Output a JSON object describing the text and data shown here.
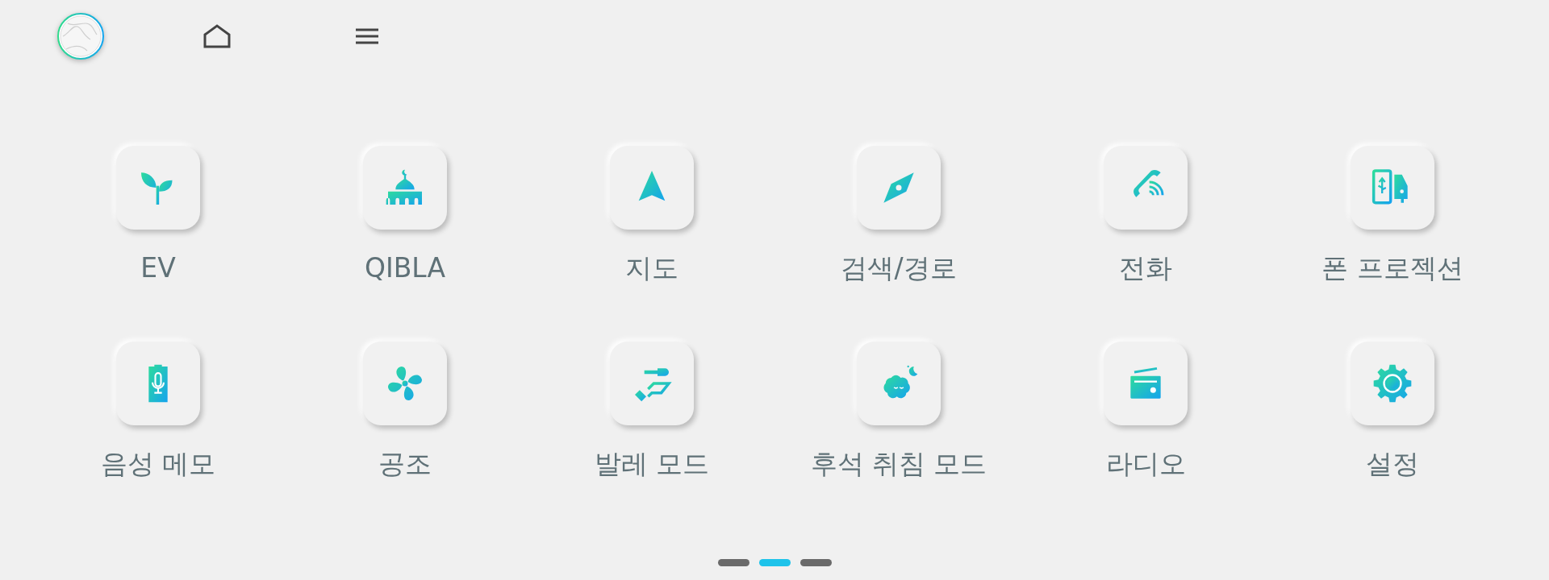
{
  "apps": [
    {
      "label": "EV"
    },
    {
      "label": "QIBLA"
    },
    {
      "label": "지도"
    },
    {
      "label": "검색/경로"
    },
    {
      "label": "전화"
    },
    {
      "label": "폰 프로젝션"
    },
    {
      "label": "음성 메모"
    },
    {
      "label": "공조"
    },
    {
      "label": "발레 모드"
    },
    {
      "label": "후석 취침 모드"
    },
    {
      "label": "라디오"
    },
    {
      "label": "설정"
    }
  ],
  "pages": [
    {
      "selected": false
    },
    {
      "selected": true
    },
    {
      "selected": false
    }
  ]
}
